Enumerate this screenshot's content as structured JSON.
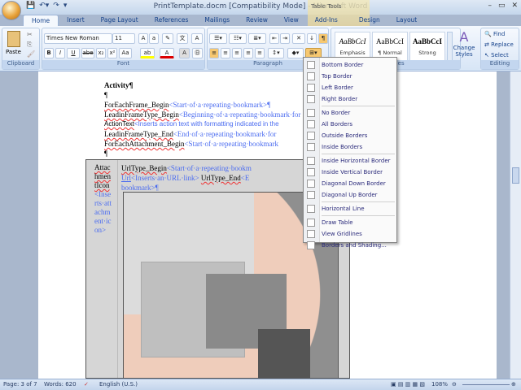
{
  "window": {
    "title": "PrintTemplate.docm [Compatibility Mode] - Microsoft Word",
    "context_tab": "Table Tools",
    "controls": [
      "–",
      "▭",
      "✕"
    ]
  },
  "tabs": [
    "Home",
    "Insert",
    "Page Layout",
    "References",
    "Mailings",
    "Review",
    "View",
    "Add-Ins",
    "Design",
    "Layout"
  ],
  "ribbon": {
    "clipboard": {
      "label": "Clipboard",
      "paste": "Paste"
    },
    "font": {
      "label": "Font",
      "name": "Times New Roman",
      "size": "11",
      "buttons": [
        "B",
        "I",
        "U",
        "abe",
        "x₂",
        "x²",
        "Aa",
        "A",
        "A"
      ]
    },
    "paragraph": {
      "label": "Paragraph"
    },
    "styles": {
      "label": "Styles",
      "items": [
        {
          "preview": "AaBbCcI",
          "name": "Emphasis"
        },
        {
          "preview": "AaBbCcI",
          "name": "¶ Normal"
        },
        {
          "preview": "AaBbCcI",
          "name": "Strong"
        }
      ],
      "change": "Change Styles"
    },
    "editing": {
      "label": "Editing",
      "find": "Find",
      "replace": "Replace",
      "select": "Select"
    }
  },
  "document": {
    "heading": "Activity¶",
    "lines": [
      {
        "field": "ForEachFrame_Begin",
        "note": "<Start·of·a·repeating·bookmark>¶"
      },
      {
        "field": "LeadinFrameType_Begin",
        "note": "<Beginning·of·a·repeating·bookmark·for"
      },
      {
        "field": "ActionText",
        "note": "<Inserts action text with formatting indicated in the"
      },
      {
        "field": "LeadinFrameType_End",
        "note": "<End·of·a·repeating·bookmark·for"
      },
      {
        "field": "ForEachAttachment_Begin",
        "note": "<Start·of·a·repeating·bookmark"
      }
    ],
    "cell1": {
      "field": "AttachmentIcon",
      "note": "<Inserts·attachment·icon>"
    },
    "cell2": {
      "line1_field": "UrlType_Begin",
      "line1_note": "<Start·of·a·repeating·bookm",
      "url_field": "Url",
      "url_note": "<Inserts·an·URL·link>",
      "end_field": "UrlType_End",
      "end_note": "<E",
      "line3": "bookmark>¶"
    }
  },
  "border_menu": [
    {
      "label": "Bottom Border"
    },
    {
      "label": "Top Border"
    },
    {
      "label": "Left Border"
    },
    {
      "label": "Right Border"
    },
    {
      "label": "No Border"
    },
    {
      "label": "All Borders"
    },
    {
      "label": "Outside Borders"
    },
    {
      "label": "Inside Borders"
    },
    {
      "label": "Inside Horizontal Border"
    },
    {
      "label": "Inside Vertical Border"
    },
    {
      "label": "Diagonal Down Border"
    },
    {
      "label": "Diagonal Up Border"
    },
    {
      "label": "Horizontal Line"
    },
    {
      "label": "Draw Table"
    },
    {
      "label": "View Gridlines"
    },
    {
      "label": "Borders and Shading..."
    }
  ],
  "status": {
    "page": "Page: 3 of 7",
    "words": "Words: 620",
    "language": "English (U.S.)",
    "zoom": "108%"
  }
}
